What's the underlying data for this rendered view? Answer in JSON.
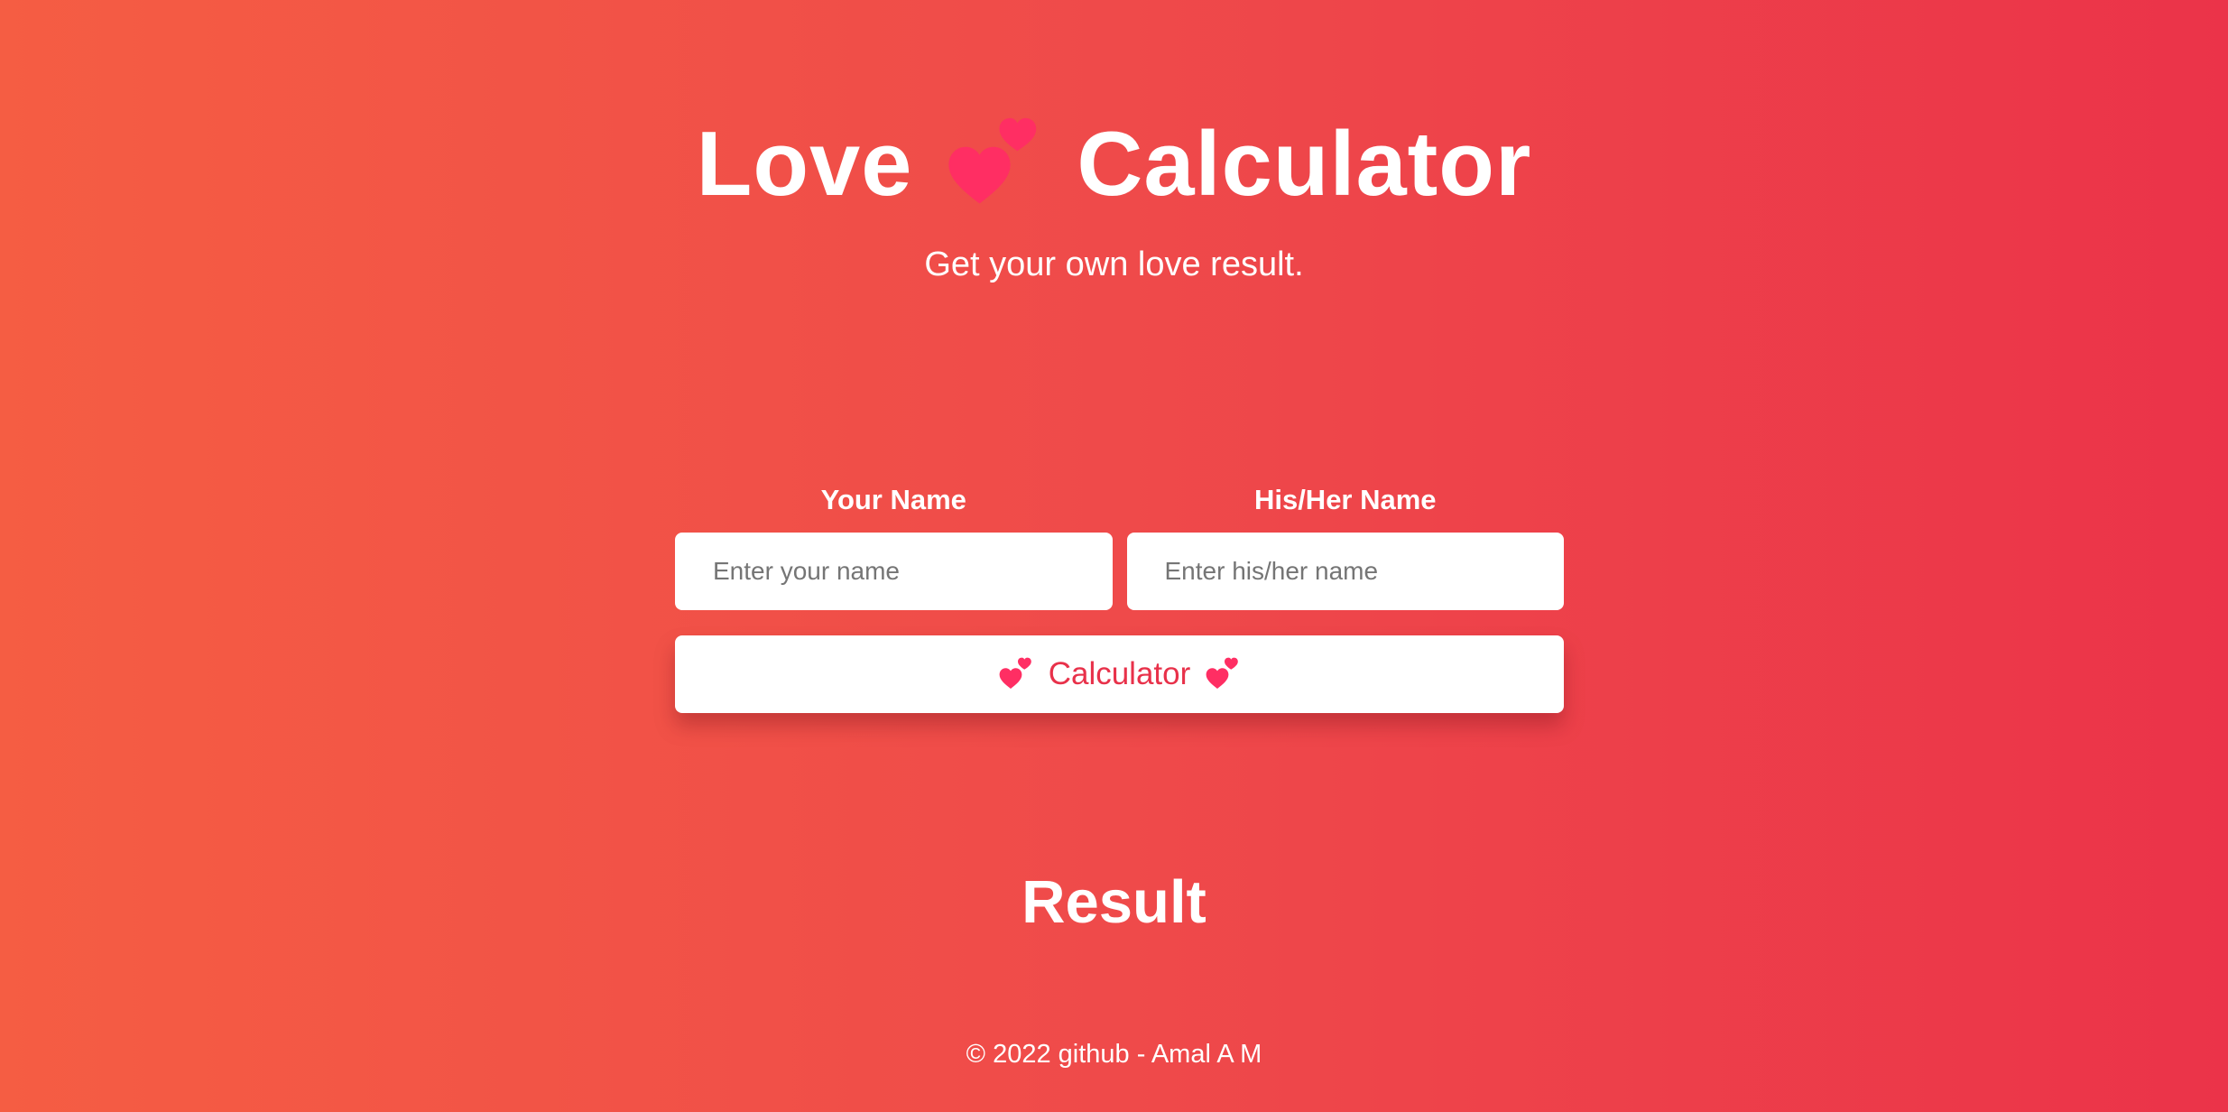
{
  "header": {
    "title_left": "Love",
    "title_right": "Calculator",
    "hearts_icon": "two-hearts-icon",
    "subtitle": "Get your own love result."
  },
  "form": {
    "your_name_label": "Your Name",
    "your_name_placeholder": "Enter your name",
    "your_name_value": "",
    "partner_name_label": "His/Her Name",
    "partner_name_placeholder": "Enter his/her name",
    "partner_name_value": "",
    "button_label": "Calculator",
    "button_icon": "two-hearts-icon"
  },
  "result": {
    "heading": "Result"
  },
  "footer": {
    "text": "© 2022 github - Amal A M"
  },
  "colors": {
    "gradient_start": "#f55d43",
    "gradient_end": "#eb3349",
    "heart": "#ff2e63",
    "button_text": "#e8314a",
    "text": "#ffffff"
  }
}
